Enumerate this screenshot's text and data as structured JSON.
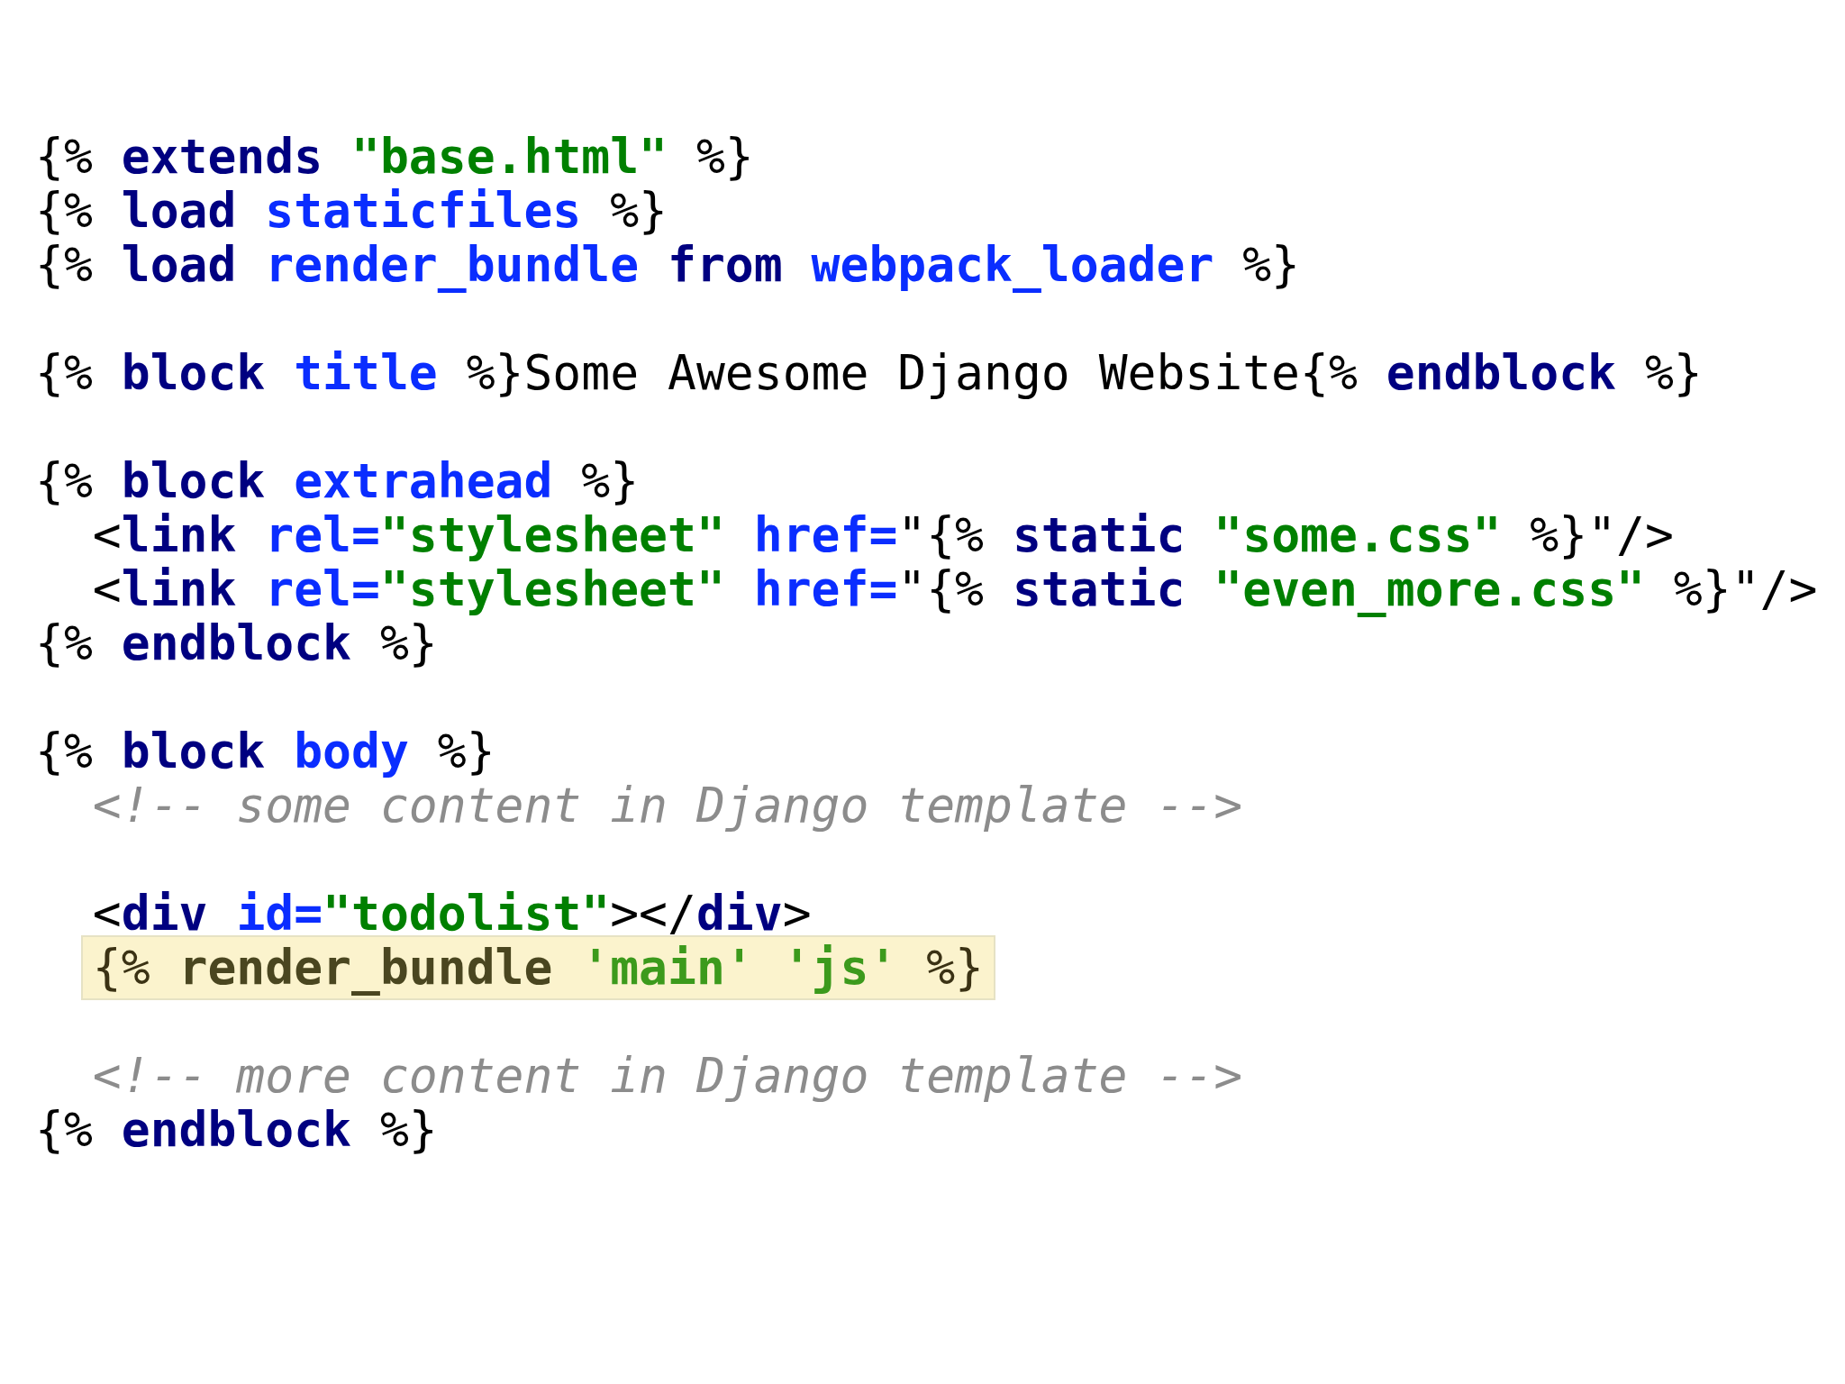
{
  "editor": {
    "blocks": [
      {
        "lines": [
          {
            "indented": false,
            "highlighted": false,
            "tokens": [
              {
                "t": "{% ",
                "kind": "punct"
              },
              {
                "t": "extends ",
                "kind": "keyword"
              },
              {
                "t": "\"base.html\"",
                "kind": "string"
              },
              {
                "t": " %}",
                "kind": "punct"
              }
            ]
          },
          {
            "indented": false,
            "highlighted": false,
            "tokens": [
              {
                "t": "{% ",
                "kind": "punct"
              },
              {
                "t": "load ",
                "kind": "keyword"
              },
              {
                "t": "staticfiles",
                "kind": "name"
              },
              {
                "t": " %}",
                "kind": "punct"
              }
            ]
          },
          {
            "indented": false,
            "highlighted": false,
            "tokens": [
              {
                "t": "{% ",
                "kind": "punct"
              },
              {
                "t": "load ",
                "kind": "keyword"
              },
              {
                "t": "render_bundle ",
                "kind": "name"
              },
              {
                "t": "from ",
                "kind": "keyword"
              },
              {
                "t": "webpack_loader",
                "kind": "name"
              },
              {
                "t": " %}",
                "kind": "punct"
              }
            ]
          }
        ]
      },
      {
        "lines": [
          {
            "indented": false,
            "highlighted": false,
            "tokens": [
              {
                "t": "{% ",
                "kind": "punct"
              },
              {
                "t": "block ",
                "kind": "keyword"
              },
              {
                "t": "title",
                "kind": "name"
              },
              {
                "t": " %}Some Awesome Django Website{% ",
                "kind": "punct"
              },
              {
                "t": "endblock",
                "kind": "keyword"
              },
              {
                "t": " %}",
                "kind": "punct"
              }
            ]
          }
        ]
      },
      {
        "lines": [
          {
            "indented": false,
            "highlighted": false,
            "tokens": [
              {
                "t": "{% ",
                "kind": "punct"
              },
              {
                "t": "block ",
                "kind": "keyword"
              },
              {
                "t": "extrahead",
                "kind": "name"
              },
              {
                "t": " %}",
                "kind": "punct"
              }
            ]
          },
          {
            "indented": true,
            "highlighted": false,
            "tokens": [
              {
                "t": "<",
                "kind": "punct"
              },
              {
                "t": "link ",
                "kind": "keyword"
              },
              {
                "t": "rel=",
                "kind": "name"
              },
              {
                "t": "\"stylesheet\" ",
                "kind": "string"
              },
              {
                "t": "href=",
                "kind": "name"
              },
              {
                "t": "\"{% ",
                "kind": "punct"
              },
              {
                "t": "static ",
                "kind": "keyword"
              },
              {
                "t": "\"some.css\"",
                "kind": "string"
              },
              {
                "t": " %}\"/>",
                "kind": "punct"
              }
            ]
          },
          {
            "indented": true,
            "highlighted": false,
            "tokens": [
              {
                "t": "<",
                "kind": "punct"
              },
              {
                "t": "link ",
                "kind": "keyword"
              },
              {
                "t": "rel=",
                "kind": "name"
              },
              {
                "t": "\"stylesheet\" ",
                "kind": "string"
              },
              {
                "t": "href=",
                "kind": "name"
              },
              {
                "t": "\"{% ",
                "kind": "punct"
              },
              {
                "t": "static ",
                "kind": "keyword"
              },
              {
                "t": "\"even_more.css\"",
                "kind": "string"
              },
              {
                "t": " %}\"/>",
                "kind": "punct"
              }
            ]
          },
          {
            "indented": false,
            "highlighted": false,
            "tokens": [
              {
                "t": "{% ",
                "kind": "punct"
              },
              {
                "t": "endblock",
                "kind": "keyword"
              },
              {
                "t": " %}",
                "kind": "punct"
              }
            ]
          }
        ]
      },
      {
        "lines": [
          {
            "indented": false,
            "highlighted": false,
            "tokens": [
              {
                "t": "{% ",
                "kind": "punct"
              },
              {
                "t": "block ",
                "kind": "keyword"
              },
              {
                "t": "body",
                "kind": "name"
              },
              {
                "t": " %}",
                "kind": "punct"
              }
            ]
          },
          {
            "indented": true,
            "highlighted": false,
            "tokens": [
              {
                "t": "<!-- some content in Django template -->",
                "kind": "comment"
              }
            ]
          }
        ]
      },
      {
        "lines": [
          {
            "indented": true,
            "highlighted": false,
            "tokens": [
              {
                "t": "<",
                "kind": "punct"
              },
              {
                "t": "div ",
                "kind": "keyword"
              },
              {
                "t": "id=",
                "kind": "name"
              },
              {
                "t": "\"todolist\"",
                "kind": "string"
              },
              {
                "t": "></",
                "kind": "punct"
              },
              {
                "t": "div",
                "kind": "keyword"
              },
              {
                "t": ">",
                "kind": "punct"
              }
            ]
          },
          {
            "indented": true,
            "highlighted": true,
            "tokens": [
              {
                "t": "{% ",
                "kind": "punct"
              },
              {
                "t": "render_bundle ",
                "kind": "keyword"
              },
              {
                "t": "'main' 'js'",
                "kind": "string"
              },
              {
                "t": " %}",
                "kind": "punct"
              }
            ]
          }
        ]
      },
      {
        "lines": [
          {
            "indented": true,
            "highlighted": false,
            "tokens": [
              {
                "t": "<!-- more content in Django template -->",
                "kind": "comment"
              }
            ]
          },
          {
            "indented": false,
            "highlighted": false,
            "tokens": [
              {
                "t": "{% ",
                "kind": "punct"
              },
              {
                "t": "endblock",
                "kind": "keyword"
              },
              {
                "t": " %}",
                "kind": "punct"
              }
            ]
          }
        ]
      }
    ]
  }
}
